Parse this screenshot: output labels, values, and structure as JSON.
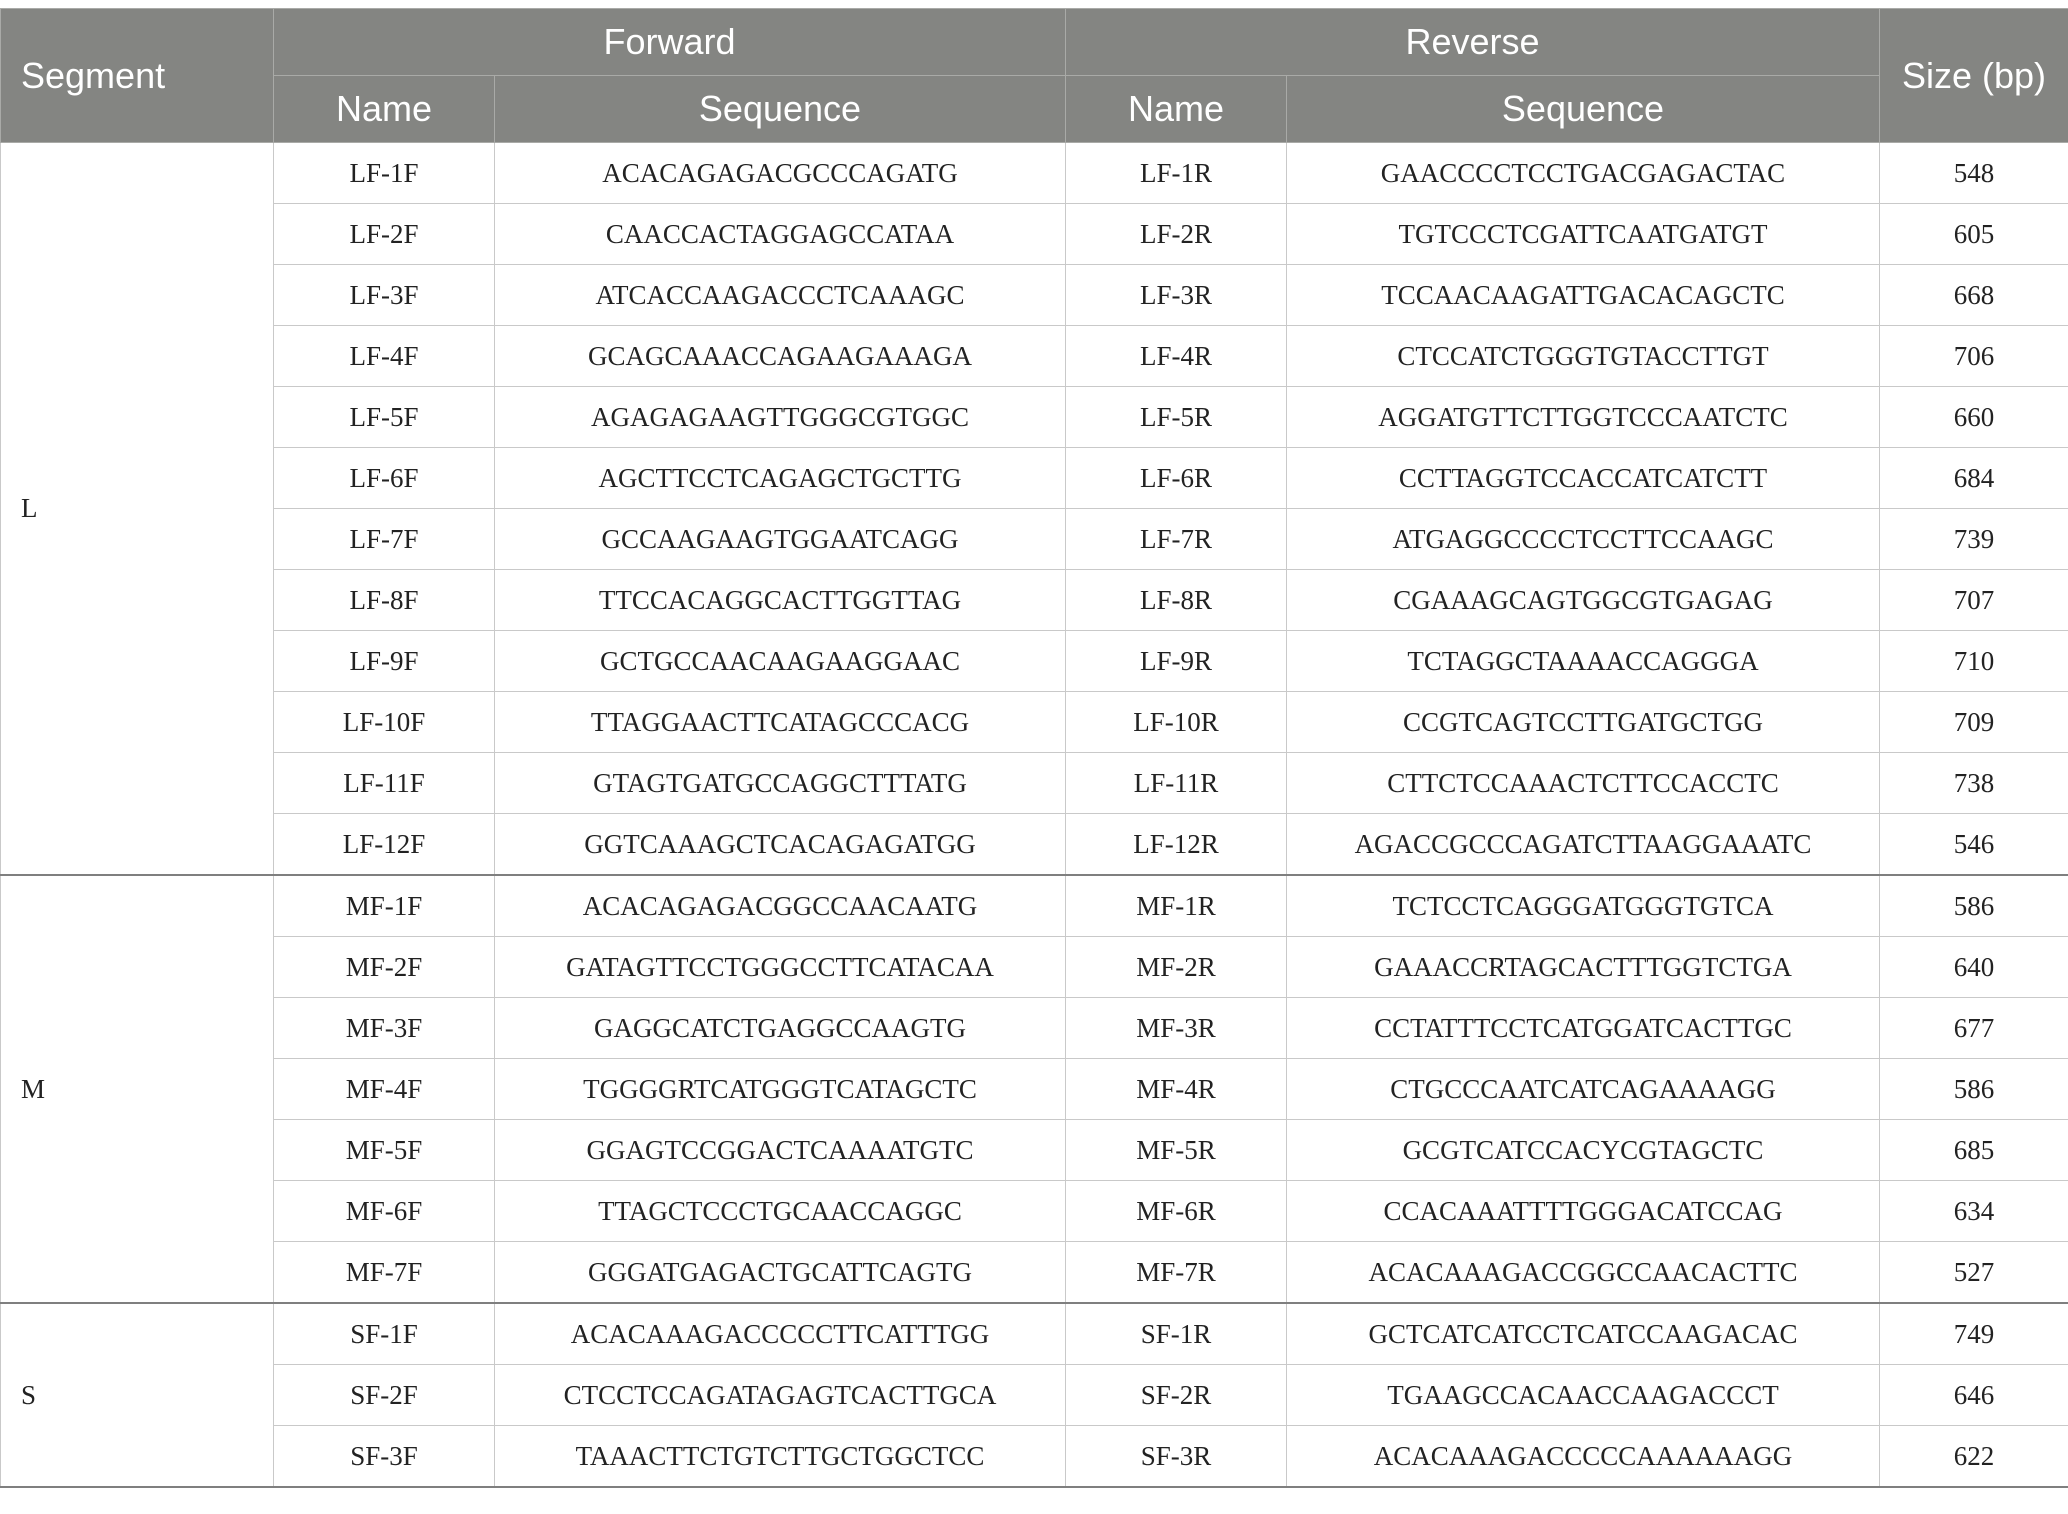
{
  "header": {
    "segment": "Segment",
    "forward": "Forward",
    "reverse": "Reverse",
    "size": "Size (bp)",
    "fwd_name": "Name",
    "fwd_seq": "Sequence",
    "rev_name": "Name",
    "rev_seq": "Sequence"
  },
  "groups": [
    {
      "segment": "L",
      "rows": [
        {
          "fname": "LF-1F",
          "fseq": "ACACAGAGACGCCCAGATG",
          "rname": "LF-1R",
          "rseq": "GAACCCCTCCTGACGAGACTAC",
          "size": "548"
        },
        {
          "fname": "LF-2F",
          "fseq": "CAACCACTAGGAGCCATAA",
          "rname": "LF-2R",
          "rseq": "TGTCCCTCGATTCAATGATGT",
          "size": "605"
        },
        {
          "fname": "LF-3F",
          "fseq": "ATCACCAAGACCCTCAAAGC",
          "rname": "LF-3R",
          "rseq": "TCCAACAAGATTGACACAGCTC",
          "size": "668"
        },
        {
          "fname": "LF-4F",
          "fseq": "GCAGCAAACCAGAAGAAAGA",
          "rname": "LF-4R",
          "rseq": "CTCCATCTGGGTGTACCTTGT",
          "size": "706"
        },
        {
          "fname": "LF-5F",
          "fseq": "AGAGAGAAGTTGGGCGTGGC",
          "rname": "LF-5R",
          "rseq": "AGGATGTTCTTGGTCCCAATCTC",
          "size": "660"
        },
        {
          "fname": "LF-6F",
          "fseq": "AGCTTCCTCAGAGCTGCTTG",
          "rname": "LF-6R",
          "rseq": "CCTTAGGTCCACCATCATCTT",
          "size": "684"
        },
        {
          "fname": "LF-7F",
          "fseq": "GCCAAGAAGTGGAATCAGG",
          "rname": "LF-7R",
          "rseq": "ATGAGGCCCCTCCTTCCAAGC",
          "size": "739"
        },
        {
          "fname": "LF-8F",
          "fseq": "TTCCACAGGCACTTGGTTAG",
          "rname": "LF-8R",
          "rseq": "CGAAAGCAGTGGCGTGAGAG",
          "size": "707"
        },
        {
          "fname": "LF-9F",
          "fseq": "GCTGCCAACAAGAAGGAAC",
          "rname": "LF-9R",
          "rseq": "TCTAGGCTAAAACCAGGGA",
          "size": "710"
        },
        {
          "fname": "LF-10F",
          "fseq": "TTAGGAACTTCATAGCCCACG",
          "rname": "LF-10R",
          "rseq": "CCGTCAGTCCTTGATGCTGG",
          "size": "709"
        },
        {
          "fname": "LF-11F",
          "fseq": "GTAGTGATGCCAGGCTTTATG",
          "rname": "LF-11R",
          "rseq": "CTTCTCCAAACTCTTCCACCTC",
          "size": "738"
        },
        {
          "fname": "LF-12F",
          "fseq": "GGTCAAAGCTCACAGAGATGG",
          "rname": "LF-12R",
          "rseq": "AGACCGCCCAGATCTTAAGGAAATC",
          "size": "546"
        }
      ]
    },
    {
      "segment": "M",
      "rows": [
        {
          "fname": "MF-1F",
          "fseq": "ACACAGAGACGGCCAACAATG",
          "rname": "MF-1R",
          "rseq": "TCTCCTCAGGGATGGGTGTCA",
          "size": "586"
        },
        {
          "fname": "MF-2F",
          "fseq": "GATAGTTCCTGGGCCTTCATACAA",
          "rname": "MF-2R",
          "rseq": "GAAACCRTAGCACTTTGGTCTGA",
          "size": "640"
        },
        {
          "fname": "MF-3F",
          "fseq": "GAGGCATCTGAGGCCAAGTG",
          "rname": "MF-3R",
          "rseq": "CCTATTTCCTCATGGATCACTTGC",
          "size": "677"
        },
        {
          "fname": "MF-4F",
          "fseq": "TGGGGRTCATGGGTCATAGCTC",
          "rname": "MF-4R",
          "rseq": "CTGCCCAATCATCAGAAAAGG",
          "size": "586"
        },
        {
          "fname": "MF-5F",
          "fseq": "GGAGTCCGGACTCAAAATGTC",
          "rname": "MF-5R",
          "rseq": "GCGTCATCCACYCGTAGCTC",
          "size": "685"
        },
        {
          "fname": "MF-6F",
          "fseq": "TTAGCTCCCTGCAACCAGGC",
          "rname": "MF-6R",
          "rseq": "CCACAAATTTTGGGACATCCAG",
          "size": "634"
        },
        {
          "fname": "MF-7F",
          "fseq": "GGGATGAGACTGCATTCAGTG",
          "rname": "MF-7R",
          "rseq": "ACACAAAGACCGGCCAACACTTC",
          "size": "527"
        }
      ]
    },
    {
      "segment": "S",
      "rows": [
        {
          "fname": "SF-1F",
          "fseq": "ACACAAAGACCCCCTTCATTTGG",
          "rname": "SF-1R",
          "rseq": "GCTCATCATCCTCATCCAAGACAC",
          "size": "749"
        },
        {
          "fname": "SF-2F",
          "fseq": "CTCCTCCAGATAGAGTCACTTGCA",
          "rname": "SF-2R",
          "rseq": "TGAAGCCACAACCAAGACCCT",
          "size": "646"
        },
        {
          "fname": "SF-3F",
          "fseq": "TAAACTTCTGTCTTGCTGGCTCC",
          "rname": "SF-3R",
          "rseq": "ACACAAAGACCCCCAAAAAAGG",
          "size": "622"
        }
      ]
    }
  ]
}
